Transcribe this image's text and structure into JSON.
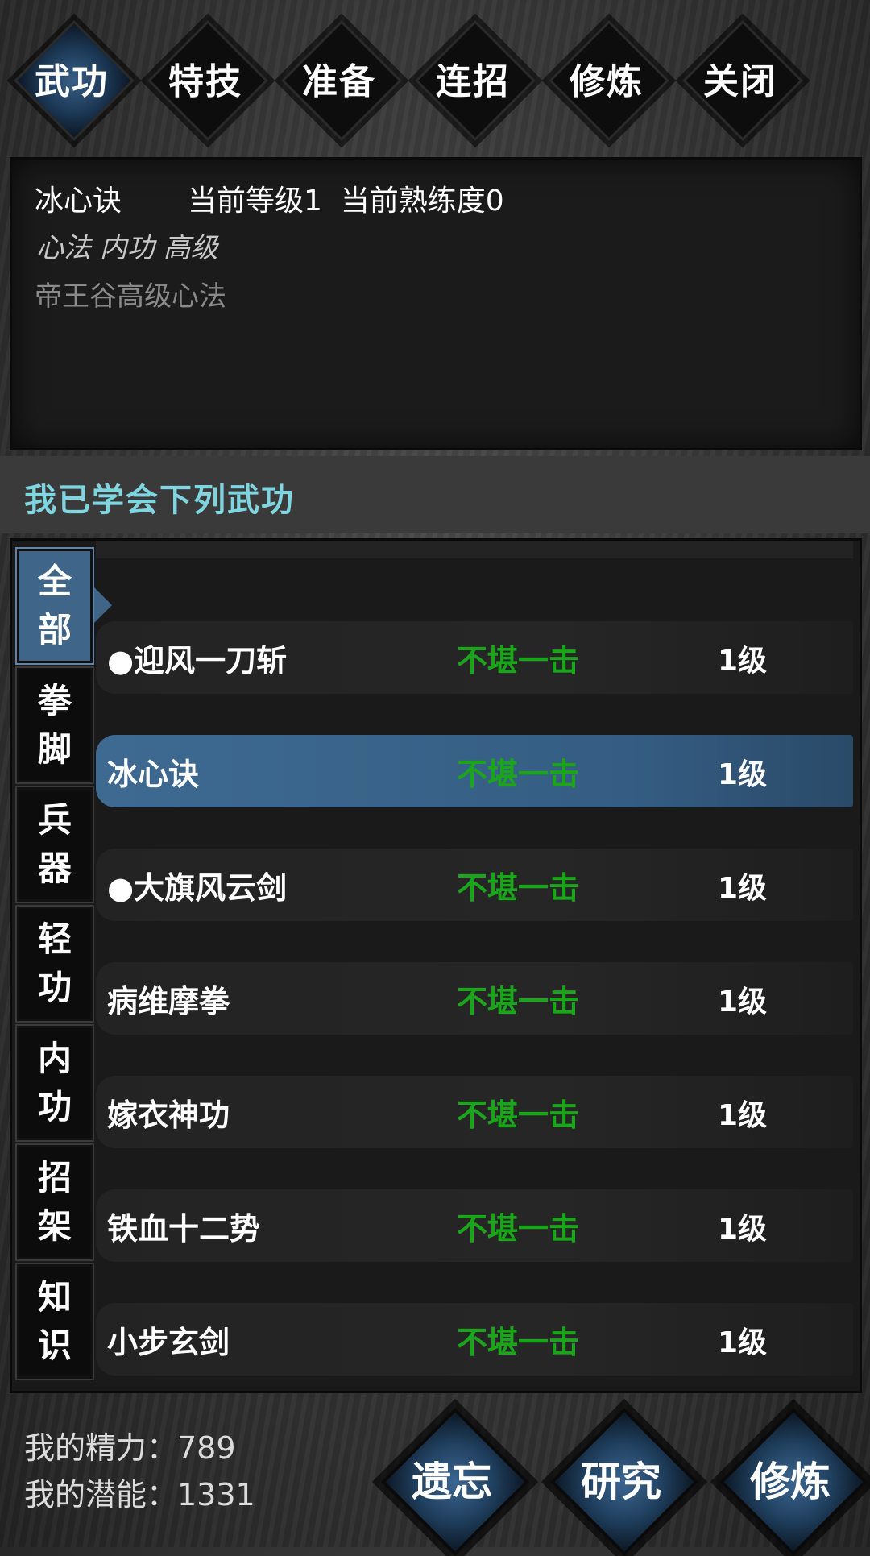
{
  "tabs": [
    {
      "label": "武功",
      "active": true
    },
    {
      "label": "特技",
      "active": false
    },
    {
      "label": "准备",
      "active": false
    },
    {
      "label": "连招",
      "active": false
    },
    {
      "label": "修炼",
      "active": false
    },
    {
      "label": "关闭",
      "active": false
    }
  ],
  "info": {
    "skill_name": "冰心诀",
    "current_level": "当前等级1",
    "current_proficiency": "当前熟练度0",
    "tags": "心法 内功 高级",
    "description": "帝王谷高级心法"
  },
  "section_title": "我已学会下列武功",
  "categories": [
    {
      "label": "全部",
      "active": true
    },
    {
      "label": "拳脚",
      "active": false
    },
    {
      "label": "兵器",
      "active": false
    },
    {
      "label": "轻功",
      "active": false
    },
    {
      "label": "内功",
      "active": false
    },
    {
      "label": "招架",
      "active": false
    },
    {
      "label": "知识",
      "active": false
    }
  ],
  "skills": [
    {
      "name": "●迎风一刀斩",
      "rank": "不堪一击",
      "level": "1级",
      "selected": false
    },
    {
      "name": "冰心诀",
      "rank": "不堪一击",
      "level": "1级",
      "selected": true
    },
    {
      "name": "●大旗风云剑",
      "rank": "不堪一击",
      "level": "1级",
      "selected": false
    },
    {
      "name": "病维摩拳",
      "rank": "不堪一击",
      "level": "1级",
      "selected": false
    },
    {
      "name": "嫁衣神功",
      "rank": "不堪一击",
      "level": "1级",
      "selected": false
    },
    {
      "name": "铁血十二势",
      "rank": "不堪一击",
      "level": "1级",
      "selected": false
    },
    {
      "name": "小步玄剑",
      "rank": "不堪一击",
      "level": "1级",
      "selected": false
    }
  ],
  "stats": {
    "energy_label": "我的精力：789",
    "potential_label": "我的潜能：1331"
  },
  "actions": [
    {
      "label": "遗忘"
    },
    {
      "label": "研究"
    },
    {
      "label": "修炼"
    }
  ],
  "colors": {
    "accent_blue": "#3f6588",
    "rank_green": "#1aa51a",
    "section_title": "#7fd6e0"
  }
}
